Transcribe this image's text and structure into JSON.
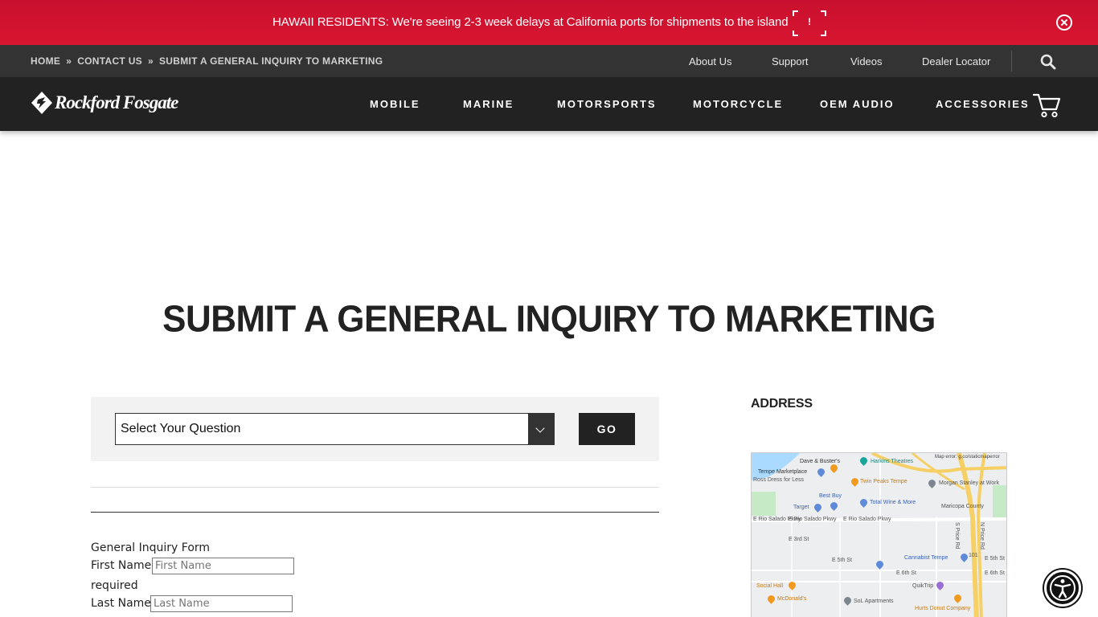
{
  "alert": {
    "message": "HAWAII RESIDENTS: We're seeing 2-3 week delays at California ports for shipments to the island",
    "badge": "!",
    "color": "#d0102a"
  },
  "breadcrumb": {
    "items": [
      "HOME",
      "CONTACT US",
      "SUBMIT A GENERAL INQUIRY TO MARKETING"
    ],
    "separator": "»"
  },
  "utility_links": [
    "About Us",
    "Support",
    "Videos",
    "Dealer Locator"
  ],
  "logo": {
    "text": "Rockford Fosgate"
  },
  "nav": {
    "items": [
      "MOBILE",
      "MARINE",
      "MOTORSPORTS",
      "MOTORCYCLE",
      "OEM AUDIO",
      "ACCESSORIES"
    ]
  },
  "page": {
    "title": "SUBMIT A GENERAL INQUIRY TO MARKETING"
  },
  "question_select": {
    "selected": "Select Your Question",
    "go_label": "GO"
  },
  "form": {
    "caption": "General Inquiry Form",
    "first_name_label": "First Name",
    "first_name_placeholder": "First Name",
    "required_text": "required",
    "last_name_label": "Last Name",
    "last_name_placeholder": "Last Name"
  },
  "address": {
    "heading": "ADDRESS"
  },
  "map": {
    "error_text": "Map error: g.co/staticmaperror",
    "labels": {
      "dave_busters": "Dave & Buster's",
      "harkins": "Harkins Theatres",
      "tempe_marketplace": "Tempe Marketplace",
      "ross": "Ross Dress for Less",
      "twin_peaks": "Twin Peaks Tempe",
      "morgan_stanley": "Morgan Stanley at Work",
      "best_buy": "Best Buy",
      "target": "Target",
      "total_wine": "Total Wine & More",
      "maricopa": "Maricopa County",
      "rio_salado_1": "E Rio Salado Pkwy",
      "rio_salado_2": "E Rio Salado Pkwy",
      "rio_salado_3": "E Rio Salado Pkwy",
      "cannabist": "Cannabist Tempe",
      "social_hall": "Social Hall",
      "mcdonalds": "McDonald's",
      "sol_apartments": "SoL Apartments",
      "quiktrip": "QuikTrip",
      "hurts_donut": "Hurts Donut Company",
      "third_st": "E 3rd St",
      "fifth_st": "E 5th St",
      "fifth_st_2": "E 5th St",
      "sixth_st": "E 6th St",
      "sixth_st_2": "E 6th St",
      "price_rd": "S Price Rd",
      "n_price_rd": "N Price Rd",
      "hwy": "101"
    }
  }
}
